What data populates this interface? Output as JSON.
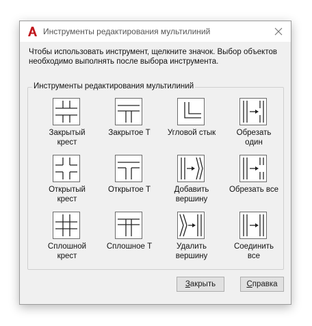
{
  "window": {
    "title": "Инструменты редактирования мультилиний",
    "app_icon": "autocad-a-icon",
    "close_icon": "close-icon"
  },
  "instructions": "Чтобы использовать инструмент, щелкните значок. Выбор объектов необходимо выполнять после выбора инструмента.",
  "group_label": "Инструменты редактирования мультилиний",
  "tools": [
    {
      "label": "Закрытый\nкрест",
      "icon": "closed-cross-icon"
    },
    {
      "label": "Закрытое Т",
      "icon": "closed-tee-icon"
    },
    {
      "label": "Угловой стык",
      "icon": "corner-joint-icon"
    },
    {
      "label": "Обрезать\nодин",
      "icon": "cut-single-icon"
    },
    {
      "label": "Открытый\nкрест",
      "icon": "open-cross-icon"
    },
    {
      "label": "Открытое Т",
      "icon": "open-tee-icon"
    },
    {
      "label": "Добавить\nвершину",
      "icon": "add-vertex-icon"
    },
    {
      "label": "Обрезать все",
      "icon": "cut-all-icon"
    },
    {
      "label": "Сплошной\nкрест",
      "icon": "merged-cross-icon"
    },
    {
      "label": "Сплошное Т",
      "icon": "merged-tee-icon"
    },
    {
      "label": "Удалить\nвершину",
      "icon": "delete-vertex-icon"
    },
    {
      "label": "Соединить\nвсе",
      "icon": "weld-all-icon"
    }
  ],
  "buttons": {
    "close_label": "Закрыть",
    "help_label": "Справка"
  },
  "colors": {
    "accent": "#c0171d",
    "dialog_bg": "#f0f0f0"
  }
}
